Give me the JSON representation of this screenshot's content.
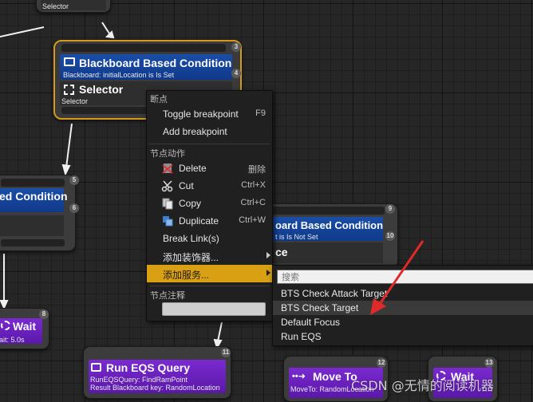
{
  "top_node": {
    "subtitle": "Selector"
  },
  "selected_node": {
    "decorator_title": "Blackboard Based Condition",
    "decorator_subtitle": "Blackboard: initialLocation is Is Set",
    "composite_title": "Selector",
    "composite_subtitle": "Selector",
    "badge_top": "3",
    "badge_bottom": "4"
  },
  "left_node": {
    "decorator_title": "ed Condition",
    "badge_top": "5",
    "badge_bottom": "6"
  },
  "left_wait": {
    "title": "Wait",
    "subtitle": "ait: 5.0s",
    "badge": "8"
  },
  "right_node": {
    "decorator_title": "oard Based Condition",
    "decorator_subtitle": "t is Is Not Set",
    "composite_title": "ce",
    "badge_top": "9",
    "badge_bottom": "10"
  },
  "run_eqs_node": {
    "title": "Run EQS Query",
    "line1": "RunEQSQuery: FindRamPoint",
    "line2": "Result Blackboard key: RandomLocation",
    "badge": "11"
  },
  "moveto_node": {
    "title": "Move To",
    "subtitle": "MoveTo: RandomLocation",
    "badge": "12"
  },
  "wait_right_node": {
    "title": "Wait",
    "badge": "13"
  },
  "context_menu": {
    "section_breakpoint": "断点",
    "toggle_breakpoint": {
      "label": "Toggle breakpoint",
      "shortcut": "F9"
    },
    "add_breakpoint": {
      "label": "Add breakpoint"
    },
    "section_node_actions": "节点动作",
    "delete": {
      "label": "Delete",
      "shortcut": "删除"
    },
    "cut": {
      "label": "Cut",
      "shortcut": "Ctrl+X"
    },
    "copy": {
      "label": "Copy",
      "shortcut": "Ctrl+C"
    },
    "duplicate": {
      "label": "Duplicate",
      "shortcut": "Ctrl+W"
    },
    "break_links": {
      "label": "Break Link(s)"
    },
    "add_decorator": {
      "label": "添加装饰器..."
    },
    "add_service": {
      "label": "添加服务..."
    },
    "section_node_comment": "节点注释",
    "comment_value": ""
  },
  "submenu": {
    "search_placeholder": "搜索",
    "items": [
      "BTS Check Attack Target",
      "BTS Check Target",
      "Default Focus",
      "Run EQS"
    ]
  },
  "watermark": "CSDN @无情的阅读机器",
  "colors": {
    "highlight": "#d39a1c",
    "decorator": "#1a4ea8",
    "task": "#6a22c0",
    "arrow": "#e02a2a"
  }
}
